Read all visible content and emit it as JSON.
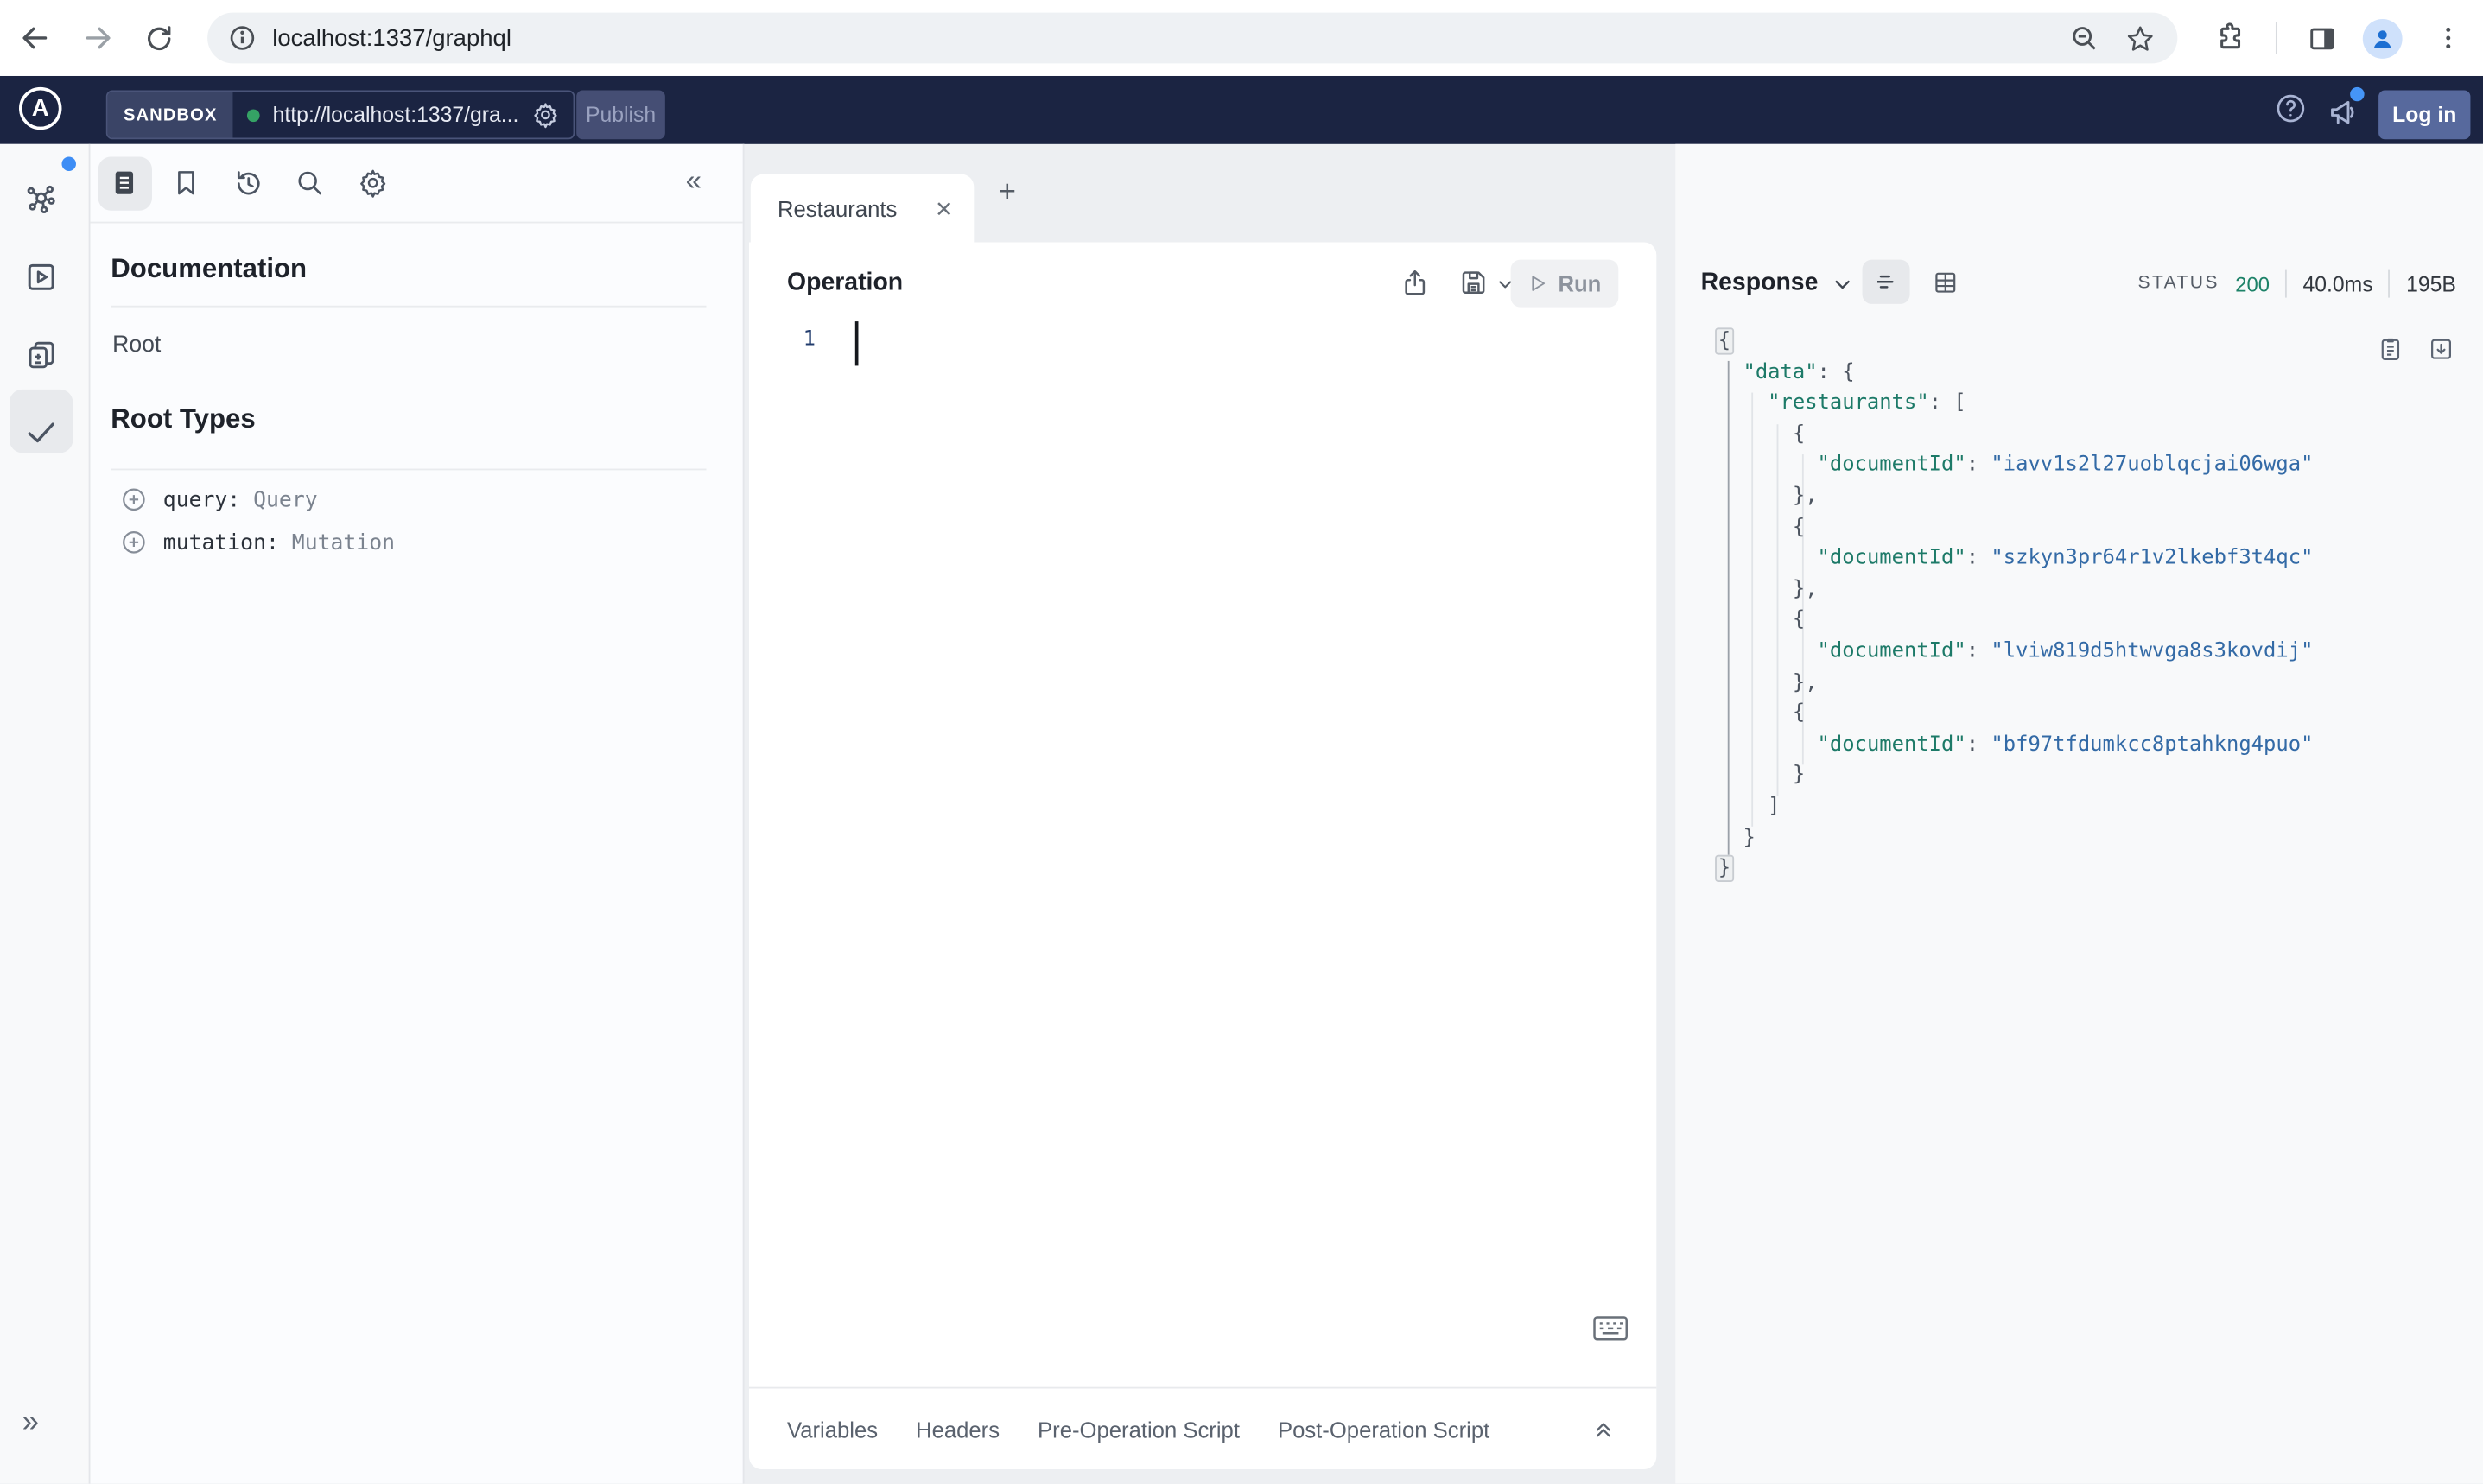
{
  "browser": {
    "url": "localhost:1337/graphql"
  },
  "app_header": {
    "logo_letter": "A",
    "env_label": "SANDBOX",
    "endpoint_url": "http://localhost:1337/gra...",
    "publish_label": "Publish",
    "login_label": "Log in"
  },
  "docs_panel": {
    "title": "Documentation",
    "root_link": "Root",
    "section_title": "Root Types",
    "root_types": [
      {
        "field": "query:",
        "type": "Query"
      },
      {
        "field": "mutation:",
        "type": "Mutation"
      }
    ]
  },
  "tabs": {
    "active_label": "Restaurants"
  },
  "operation": {
    "title": "Operation",
    "run_label": "Run",
    "line_number": "1"
  },
  "bottom_bar": {
    "tabs": [
      "Variables",
      "Headers",
      "Pre-Operation Script",
      "Post-Operation Script"
    ]
  },
  "response": {
    "title": "Response",
    "status_label": "STATUS",
    "status_code": "200",
    "duration": "40.0ms",
    "size": "195B",
    "json_lines": [
      [
        {
          "c": "pf",
          "t": "{"
        }
      ],
      [
        {
          "c": "p",
          "t": "  "
        },
        {
          "c": "k",
          "t": "\"data\""
        },
        {
          "c": "p",
          "t": ": {"
        }
      ],
      [
        {
          "c": "p",
          "t": "    "
        },
        {
          "c": "k",
          "t": "\"restaurants\""
        },
        {
          "c": "p",
          "t": ": ["
        }
      ],
      [
        {
          "c": "p",
          "t": "      {"
        }
      ],
      [
        {
          "c": "p",
          "t": "        "
        },
        {
          "c": "k",
          "t": "\"documentId\""
        },
        {
          "c": "p",
          "t": ": "
        },
        {
          "c": "s",
          "t": "\"iavv1s2l27uoblqcjai06wga\""
        }
      ],
      [
        {
          "c": "p",
          "t": "      },"
        }
      ],
      [
        {
          "c": "p",
          "t": "      {"
        }
      ],
      [
        {
          "c": "p",
          "t": "        "
        },
        {
          "c": "k",
          "t": "\"documentId\""
        },
        {
          "c": "p",
          "t": ": "
        },
        {
          "c": "s",
          "t": "\"szkyn3pr64r1v2lkebf3t4qc\""
        }
      ],
      [
        {
          "c": "p",
          "t": "      },"
        }
      ],
      [
        {
          "c": "p",
          "t": "      {"
        }
      ],
      [
        {
          "c": "p",
          "t": "        "
        },
        {
          "c": "k",
          "t": "\"documentId\""
        },
        {
          "c": "p",
          "t": ": "
        },
        {
          "c": "s",
          "t": "\"lviw819d5htwvga8s3kovdij\""
        }
      ],
      [
        {
          "c": "p",
          "t": "      },"
        }
      ],
      [
        {
          "c": "p",
          "t": "      {"
        }
      ],
      [
        {
          "c": "p",
          "t": "        "
        },
        {
          "c": "k",
          "t": "\"documentId\""
        },
        {
          "c": "p",
          "t": ": "
        },
        {
          "c": "s",
          "t": "\"bf97tfdumkcc8ptahkng4puo\""
        }
      ],
      [
        {
          "c": "p",
          "t": "      }"
        }
      ],
      [
        {
          "c": "p",
          "t": "    ]"
        }
      ],
      [
        {
          "c": "p",
          "t": "  }"
        }
      ],
      [
        {
          "c": "pf",
          "t": "}"
        }
      ]
    ]
  },
  "colors": {
    "header_bg": "#1b2442",
    "endpoint_dot_green": "#35a265",
    "status_ok_green": "#1d8268",
    "json_key_teal": "#1d7a68",
    "json_string_blue": "#336aa6",
    "login_button_bg": "#57699d",
    "notification_blue": "#3d8df5"
  }
}
